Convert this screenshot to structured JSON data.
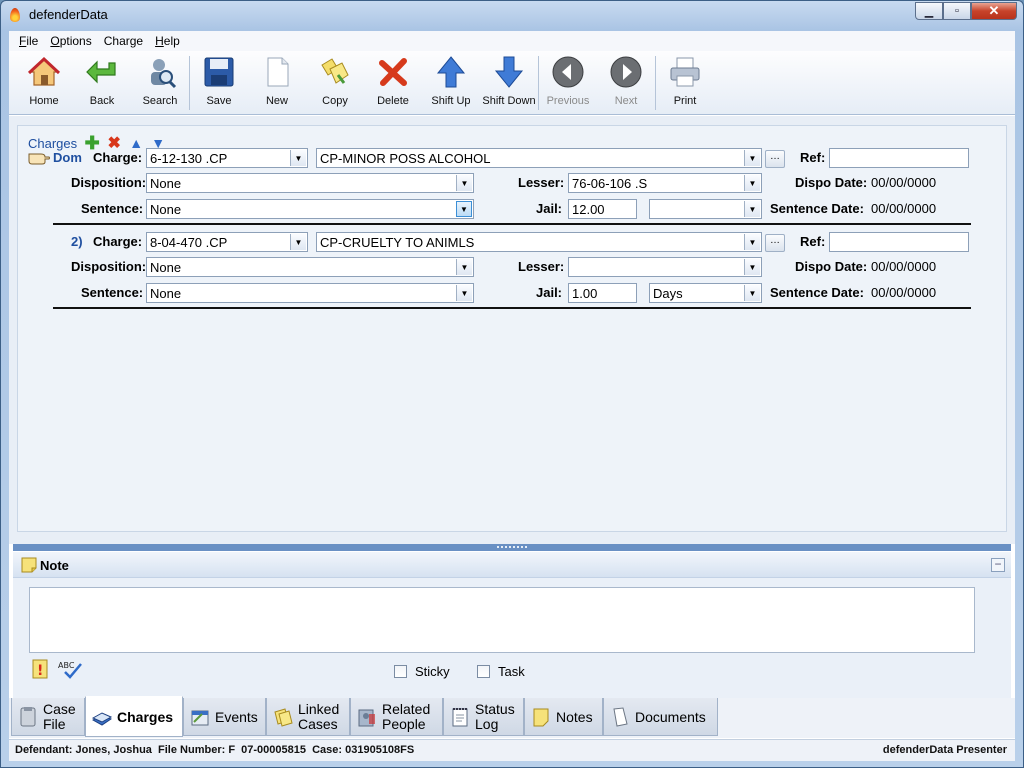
{
  "window": {
    "title": "defenderData"
  },
  "menu": [
    {
      "mnemonic": "F",
      "rest": "ile"
    },
    {
      "mnemonic": "O",
      "rest": "ptions"
    },
    {
      "mnemonic": "",
      "rest": "Charge"
    },
    {
      "mnemonic": "H",
      "rest": "elp"
    }
  ],
  "toolbar": {
    "home": "Home",
    "back": "Back",
    "search": "Search",
    "save": "Save",
    "new": "New",
    "copy": "Copy",
    "delete": "Delete",
    "shift_up": "Shift Up",
    "shift_down": "Shift Down",
    "previous": "Previous",
    "next": "Next",
    "print": "Print"
  },
  "charges": {
    "header": "Charges",
    "labels": {
      "charge": "Charge:",
      "ref": "Ref:",
      "disposition": "Disposition:",
      "lesser": "Lesser:",
      "dispo_date": "Dispo Date:",
      "sentence": "Sentence:",
      "jail": "Jail:",
      "sentence_date": "Sentence Date:"
    },
    "items": [
      {
        "marker": "Dom",
        "charge_code": "6-12-130 .CP",
        "charge_desc": "CP-MINOR POSS ALCOHOL",
        "ref": "",
        "disposition": "None",
        "lesser": "76-06-106 .S",
        "dispo_date": "00/00/0000",
        "sentence": "None",
        "jail": "12.00",
        "jail_unit": "",
        "sentence_date": "00/00/0000"
      },
      {
        "marker": "2)",
        "charge_code": "8-04-470 .CP",
        "charge_desc": "CP-CRUELTY TO ANIMLS",
        "ref": "",
        "disposition": "None",
        "lesser": "",
        "dispo_date": "00/00/0000",
        "sentence": "None",
        "jail": "1.00",
        "jail_unit": "Days",
        "sentence_date": "00/00/0000"
      }
    ]
  },
  "note": {
    "title": "Note",
    "text": "",
    "sticky": "Sticky",
    "task": "Task"
  },
  "tabs": {
    "case_file_1": "Case",
    "case_file_2": "File",
    "charges": "Charges",
    "events": "Events",
    "linked_1": "Linked",
    "linked_2": "Cases",
    "related_1": "Related",
    "related_2": "People",
    "status_1": "Status",
    "status_2": "Log",
    "notes": "Notes",
    "documents": "Documents"
  },
  "status": {
    "left": "Defendant: Jones, Joshua  File Number: F  07-00005815  Case: 031905108FS",
    "right": "defenderData Presenter"
  }
}
